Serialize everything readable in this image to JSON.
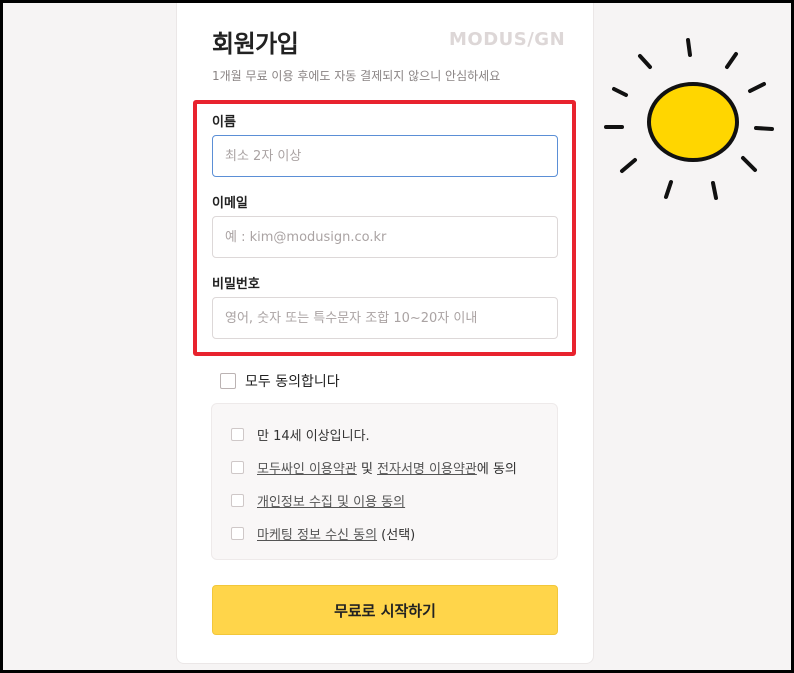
{
  "form": {
    "title": "회원가입",
    "brand": "MODUS/GN",
    "subtitle": "1개월 무료 이용 후에도 자동 결제되지 않으니 안심하세요",
    "fields": [
      {
        "label": "이름",
        "value": "",
        "placeholder": "최소 2자 이상"
      },
      {
        "label": "이메일",
        "value": "",
        "placeholder": "예 : kim@modusign.co.kr"
      },
      {
        "label": "비밀번호",
        "value": "",
        "placeholder": "영어, 숫자 또는 특수문자 조합 10~20자 이내"
      }
    ],
    "agree_all": {
      "label": "모두 동의합니다",
      "checked": false
    },
    "terms": [
      {
        "text": "만 14세 이상입니다.",
        "checked": false
      },
      {
        "link1": "모두싸인 이용약관",
        "mid": " 및 ",
        "link2": "전자서명 이용약관",
        "tail": "에 동의",
        "checked": false
      },
      {
        "link": "개인정보 수집 및 이용 동의",
        "checked": false
      },
      {
        "link": "마케팅 정보 수신 동의",
        "tail": " (선택)",
        "checked": false
      }
    ],
    "submit_label": "무료로 시작하기"
  },
  "colors": {
    "accent_button": "#ffd54a",
    "highlight_box": "#e8232e",
    "focus_border": "#5b8fd6",
    "sun": "#ffd600"
  },
  "annotation": {
    "icon": "sun-icon"
  }
}
